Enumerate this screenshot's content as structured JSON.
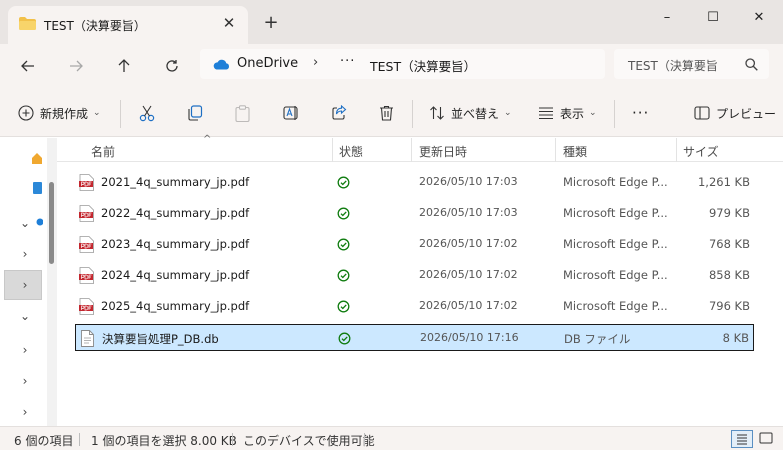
{
  "tab": {
    "title": "TEST（決算要旨）",
    "close": "✕",
    "new": "+"
  },
  "window": {
    "minimize": "–",
    "maximize": "☐",
    "close": "✕"
  },
  "address": {
    "root": "OneDrive",
    "more": "···",
    "current": "TEST（決算要旨）",
    "search_placeholder": "TEST（決算要旨"
  },
  "toolbar": {
    "new_label": "新規作成",
    "sort_label": "並べ替え",
    "view_label": "表示",
    "more": "···",
    "preview_label": "プレビュー"
  },
  "columns": {
    "name": "名前",
    "status": "状態",
    "date": "更新日時",
    "type": "種類",
    "size": "サイズ"
  },
  "files": [
    {
      "name": "2021_4q_summary_jp.pdf",
      "date": "2026/05/10 17:03",
      "type": "Microsoft Edge P...",
      "size": "1,261 KB",
      "icon": "pdf-file-icon"
    },
    {
      "name": "2022_4q_summary_jp.pdf",
      "date": "2026/05/10 17:03",
      "type": "Microsoft Edge P...",
      "size": "979 KB",
      "icon": "pdf-file-icon"
    },
    {
      "name": "2023_4q_summary_jp.pdf",
      "date": "2026/05/10 17:02",
      "type": "Microsoft Edge P...",
      "size": "768 KB",
      "icon": "pdf-file-icon"
    },
    {
      "name": "2024_4q_summary_jp.pdf",
      "date": "2026/05/10 17:02",
      "type": "Microsoft Edge P...",
      "size": "858 KB",
      "icon": "pdf-file-icon"
    },
    {
      "name": "2025_4q_summary_jp.pdf",
      "date": "2026/05/10 17:02",
      "type": "Microsoft Edge P...",
      "size": "796 KB",
      "icon": "pdf-file-icon"
    },
    {
      "name": "決算要旨処理P_DB.db",
      "date": "2026/05/10 17:16",
      "type": "DB ファイル",
      "size": "8 KB",
      "icon": "generic-file-icon",
      "selected": true
    }
  ],
  "status": {
    "item_count": "6 個の項目",
    "selection": "1 個の項目を選択  8.00 KB",
    "availability": "このデバイスで使用可能"
  },
  "colors": {
    "accent": "#0067c0",
    "selection_bg": "#cce8ff",
    "sync_ok": "#107c10",
    "pdf_red": "#c3262e"
  }
}
